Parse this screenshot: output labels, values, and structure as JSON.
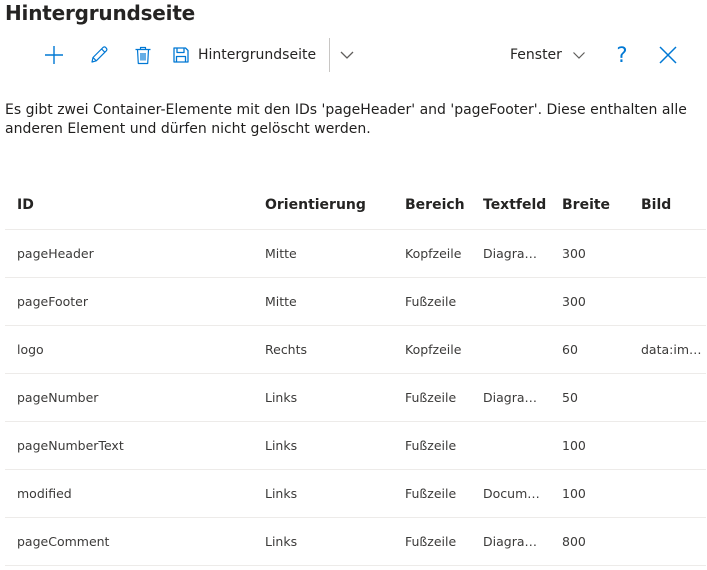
{
  "title": "Hintergrundseite",
  "toolbar": {
    "add_icon": "plus-icon",
    "edit_icon": "pencil-icon",
    "delete_icon": "trash-icon",
    "save_icon": "floppy-disk-icon",
    "save_label": "Hintergrundseite",
    "dropdown_icon": "chevron-down-icon",
    "window_label": "Fenster",
    "help_label": "?",
    "close_icon": "close-icon",
    "accent_color": "#0078d4"
  },
  "description": "Es gibt zwei Container-Elemente mit den IDs 'pageHeader' and 'pageFooter'. Diese enthalten alle anderen Element und dürfen nicht gelöscht werden.",
  "table": {
    "headers": [
      "ID",
      "Orientierung",
      "Bereich",
      "Textfeld",
      "Breite",
      "Bild"
    ],
    "rows": [
      [
        "pageHeader",
        "Mitte",
        "Kopfzeile",
        "Diagra…",
        "300",
        ""
      ],
      [
        "pageFooter",
        "Mitte",
        "Fußzeile",
        "",
        "300",
        ""
      ],
      [
        "logo",
        "Rechts",
        "Kopfzeile",
        "",
        "60",
        "data:im…"
      ],
      [
        "pageNumber",
        "Links",
        "Fußzeile",
        "Diagra…",
        "50",
        ""
      ],
      [
        "pageNumberText",
        "Links",
        "Fußzeile",
        "",
        "100",
        ""
      ],
      [
        "modified",
        "Links",
        "Fußzeile",
        "Docum…",
        "100",
        ""
      ],
      [
        "pageComment",
        "Links",
        "Fußzeile",
        "Diagra…",
        "800",
        ""
      ]
    ]
  }
}
